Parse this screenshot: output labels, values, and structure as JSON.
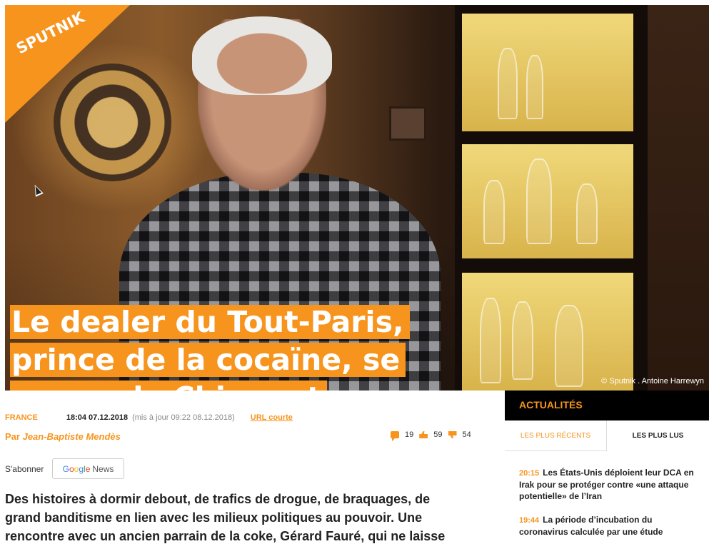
{
  "brand": {
    "logo": "SPUTNIK",
    "accent": "#f7941d"
  },
  "hero": {
    "headline_lines": [
      "Le dealer du Tout-Paris,",
      "prince de la cocaïne, se",
      "venge de Chirac et Johnny"
    ],
    "credit": "© Sputnik . Antoine Harrewyn"
  },
  "article": {
    "category": "FRANCE",
    "published": "18:04 07.12.2018",
    "updated": "(mis à jour 09:22 08.12.2018)",
    "short_url": "URL courte",
    "author_prefix": "Par",
    "author_name": "Jean-Baptiste Mendès",
    "stats": {
      "comments": "19",
      "likes": "59",
      "dislikes": "54"
    },
    "subscribe_label": "S'abonner",
    "gnews": {
      "g": "Google",
      "news": "News"
    },
    "lead": "Des histoires à dormir debout, de trafics de drogue, de braquages, de grand banditisme en lien avec les milieux politiques au pouvoir. Une rencontre avec un ancien parrain de la coke, Gérard Fauré, qui ne laisse"
  },
  "sidebar": {
    "title": "ACTUALITÉS",
    "tabs": [
      "LES PLUS RÉCENTS",
      "LES PLUS LUS"
    ],
    "items": [
      {
        "time": "20:15",
        "text": "Les États-Unis déploient leur DCA en Irak pour se protéger contre «une attaque potentielle» de l’Iran"
      },
      {
        "time": "19:44",
        "text": "La période d’incubation du coronavirus calculée par une étude"
      }
    ]
  }
}
